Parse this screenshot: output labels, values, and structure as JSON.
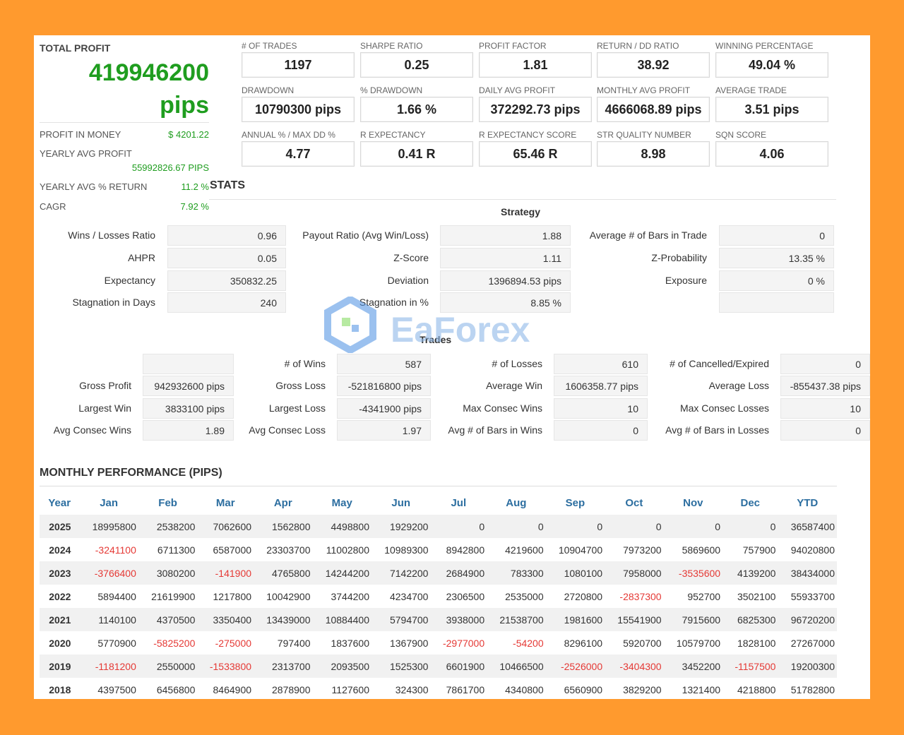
{
  "total_profit": {
    "label": "TOTAL PROFIT",
    "value": "419946200",
    "unit": "pips"
  },
  "left_stats": [
    {
      "label": "PROFIT IN MONEY",
      "value": "$ 4201.22"
    },
    {
      "label": "YEARLY AVG PROFIT",
      "value": "55992826.67 PIPS"
    },
    {
      "label": "YEARLY AVG % RETURN",
      "value": "11.2 %"
    },
    {
      "label": "CAGR",
      "value": "7.92 %"
    }
  ],
  "boxes": [
    {
      "label": "# OF TRADES",
      "value": "1197"
    },
    {
      "label": "SHARPE RATIO",
      "value": "0.25"
    },
    {
      "label": "PROFIT FACTOR",
      "value": "1.81"
    },
    {
      "label": "RETURN / DD RATIO",
      "value": "38.92"
    },
    {
      "label": "WINNING PERCENTAGE",
      "value": "49.04 %"
    },
    {
      "label": "DRAWDOWN",
      "value": "10790300 pips"
    },
    {
      "label": "% DRAWDOWN",
      "value": "1.66 %"
    },
    {
      "label": "DAILY AVG PROFIT",
      "value": "372292.73 pips"
    },
    {
      "label": "MONTHLY AVG PROFIT",
      "value": "4666068.89 pips"
    },
    {
      "label": "AVERAGE TRADE",
      "value": "3.51 pips"
    },
    {
      "label": "ANNUAL % / MAX DD %",
      "value": "4.77"
    },
    {
      "label": "R EXPECTANCY",
      "value": "0.41 R"
    },
    {
      "label": "R EXPECTANCY SCORE",
      "value": "65.46 R"
    },
    {
      "label": "STR QUALITY NUMBER",
      "value": "8.98"
    },
    {
      "label": "SQN SCORE",
      "value": "4.06"
    }
  ],
  "stats_title": "STATS",
  "strategy": {
    "title": "Strategy",
    "rows": [
      [
        {
          "label": "Wins / Losses Ratio",
          "value": "0.96"
        },
        {
          "label": "Payout Ratio (Avg Win/Loss)",
          "value": "1.88"
        },
        {
          "label": "Average # of Bars in Trade",
          "value": "0"
        }
      ],
      [
        {
          "label": "AHPR",
          "value": "0.05"
        },
        {
          "label": "Z-Score",
          "value": "1.11"
        },
        {
          "label": "Z-Probability",
          "value": "13.35 %"
        }
      ],
      [
        {
          "label": "Expectancy",
          "value": "350832.25"
        },
        {
          "label": "Deviation",
          "value": "1396894.53 pips"
        },
        {
          "label": "Exposure",
          "value": "0 %"
        }
      ],
      [
        {
          "label": "Stagnation in Days",
          "value": "240"
        },
        {
          "label": "Stagnation in %",
          "value": "8.85 %"
        },
        {
          "label": "",
          "value": ""
        }
      ]
    ]
  },
  "trades": {
    "title": "Trades",
    "rows": [
      [
        {
          "label": "",
          "value": ""
        },
        {
          "label": "# of Wins",
          "value": "587"
        },
        {
          "label": "# of Losses",
          "value": "610"
        },
        {
          "label": "# of Cancelled/Expired",
          "value": "0"
        }
      ],
      [
        {
          "label": "Gross Profit",
          "value": "942932600 pips"
        },
        {
          "label": "Gross Loss",
          "value": "-521816800 pips"
        },
        {
          "label": "Average Win",
          "value": "1606358.77 pips"
        },
        {
          "label": "Average Loss",
          "value": "-855437.38 pips"
        }
      ],
      [
        {
          "label": "Largest Win",
          "value": "3833100 pips"
        },
        {
          "label": "Largest Loss",
          "value": "-4341900 pips"
        },
        {
          "label": "Max Consec Wins",
          "value": "10"
        },
        {
          "label": "Max Consec Losses",
          "value": "10"
        }
      ],
      [
        {
          "label": "Avg Consec Wins",
          "value": "1.89"
        },
        {
          "label": "Avg Consec Loss",
          "value": "1.97"
        },
        {
          "label": "Avg # of Bars in Wins",
          "value": "0"
        },
        {
          "label": "Avg # of Bars in Losses",
          "value": "0"
        }
      ]
    ]
  },
  "watermark": "EaForex",
  "monthly": {
    "title": "MONTHLY PERFORMANCE (PIPS)",
    "headers": [
      "Year",
      "Jan",
      "Feb",
      "Mar",
      "Apr",
      "May",
      "Jun",
      "Jul",
      "Aug",
      "Sep",
      "Oct",
      "Nov",
      "Dec",
      "YTD"
    ],
    "rows": [
      [
        "2025",
        "18995800",
        "2538200",
        "7062600",
        "1562800",
        "4498800",
        "1929200",
        "0",
        "0",
        "0",
        "0",
        "0",
        "0",
        "36587400"
      ],
      [
        "2024",
        "-3241100",
        "6711300",
        "6587000",
        "23303700",
        "11002800",
        "10989300",
        "8942800",
        "4219600",
        "10904700",
        "7973200",
        "5869600",
        "757900",
        "94020800"
      ],
      [
        "2023",
        "-3766400",
        "3080200",
        "-141900",
        "4765800",
        "14244200",
        "7142200",
        "2684900",
        "783300",
        "1080100",
        "7958000",
        "-3535600",
        "4139200",
        "38434000"
      ],
      [
        "2022",
        "5894400",
        "21619900",
        "1217800",
        "10042900",
        "3744200",
        "4234700",
        "2306500",
        "2535000",
        "2720800",
        "-2837300",
        "952700",
        "3502100",
        "55933700"
      ],
      [
        "2021",
        "1140100",
        "4370500",
        "3350400",
        "13439000",
        "10884400",
        "5794700",
        "3938000",
        "21538700",
        "1981600",
        "15541900",
        "7915600",
        "6825300",
        "96720200"
      ],
      [
        "2020",
        "5770900",
        "-5825200",
        "-275000",
        "797400",
        "1837600",
        "1367900",
        "-2977000",
        "-54200",
        "8296100",
        "5920700",
        "10579700",
        "1828100",
        "27267000"
      ],
      [
        "2019",
        "-1181200",
        "2550000",
        "-1533800",
        "2313700",
        "2093500",
        "1525300",
        "6601900",
        "10466500",
        "-2526000",
        "-3404300",
        "3452200",
        "-1157500",
        "19200300"
      ],
      [
        "2018",
        "4397500",
        "6456800",
        "8464900",
        "2878900",
        "1127600",
        "324300",
        "7861700",
        "4340800",
        "6560900",
        "3829200",
        "1321400",
        "4218800",
        "51782800"
      ]
    ]
  }
}
